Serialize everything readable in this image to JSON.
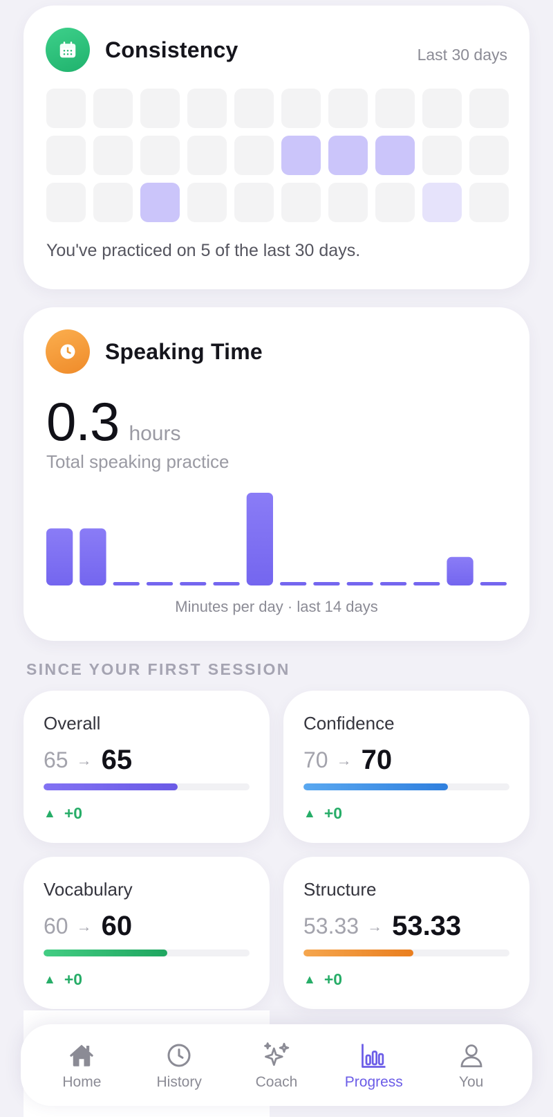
{
  "consistency": {
    "title": "Consistency",
    "range_label": "Last 30 days",
    "summary": "You've practiced on 5 of the last 30 days.",
    "icon": "calendar-icon",
    "levels": [
      0,
      0,
      0,
      0,
      0,
      0,
      0,
      0,
      0,
      0,
      0,
      0,
      0,
      0,
      0,
      2,
      2,
      2,
      0,
      0,
      0,
      0,
      2,
      0,
      0,
      0,
      0,
      0,
      1,
      0
    ],
    "colors": {
      "empty": "#f3f3f4",
      "level1": "#e6e3fb",
      "level2": "#cbc5fa"
    }
  },
  "speaking": {
    "title": "Speaking Time",
    "icon": "clock-icon",
    "value": "0.3",
    "unit": "hours",
    "subtitle": "Total speaking practice",
    "caption": "Minutes per day · last 14 days"
  },
  "chart_data": {
    "type": "bar",
    "values": [
      4,
      4,
      0,
      0,
      0,
      0,
      6.5,
      0,
      0,
      0,
      0,
      0,
      2,
      0
    ],
    "ylim": [
      0,
      6.5
    ],
    "xlabel": "Minutes per day · last 14 days",
    "color": "#7466ef"
  },
  "section": {
    "title": "SINCE YOUR FIRST SESSION"
  },
  "metrics": [
    {
      "label": "Overall",
      "from": "65",
      "to": "65",
      "progress": 0.65,
      "delta": "+0",
      "color_start": "#8272f3",
      "color_end": "#6a5ae6"
    },
    {
      "label": "Confidence",
      "from": "70",
      "to": "70",
      "progress": 0.7,
      "delta": "+0",
      "color_start": "#5aa8f0",
      "color_end": "#2f7fde"
    },
    {
      "label": "Vocabulary",
      "from": "60",
      "to": "60",
      "progress": 0.6,
      "delta": "+0",
      "color_start": "#43cd83",
      "color_end": "#1fa660"
    },
    {
      "label": "Structure",
      "from": "53.33",
      "to": "53.33",
      "progress": 0.5333,
      "delta": "+0",
      "color_start": "#f5a64e",
      "color_end": "#e97e1f"
    }
  ],
  "nav": {
    "items": [
      {
        "label": "Home",
        "icon": "home-icon"
      },
      {
        "label": "History",
        "icon": "history-icon"
      },
      {
        "label": "Coach",
        "icon": "sparkles-icon"
      },
      {
        "label": "Progress",
        "icon": "bar-chart-icon",
        "active": true
      },
      {
        "label": "You",
        "icon": "user-icon"
      }
    ],
    "colors": {
      "inactive": "#8b8b95",
      "active": "#6b5ce7"
    }
  }
}
